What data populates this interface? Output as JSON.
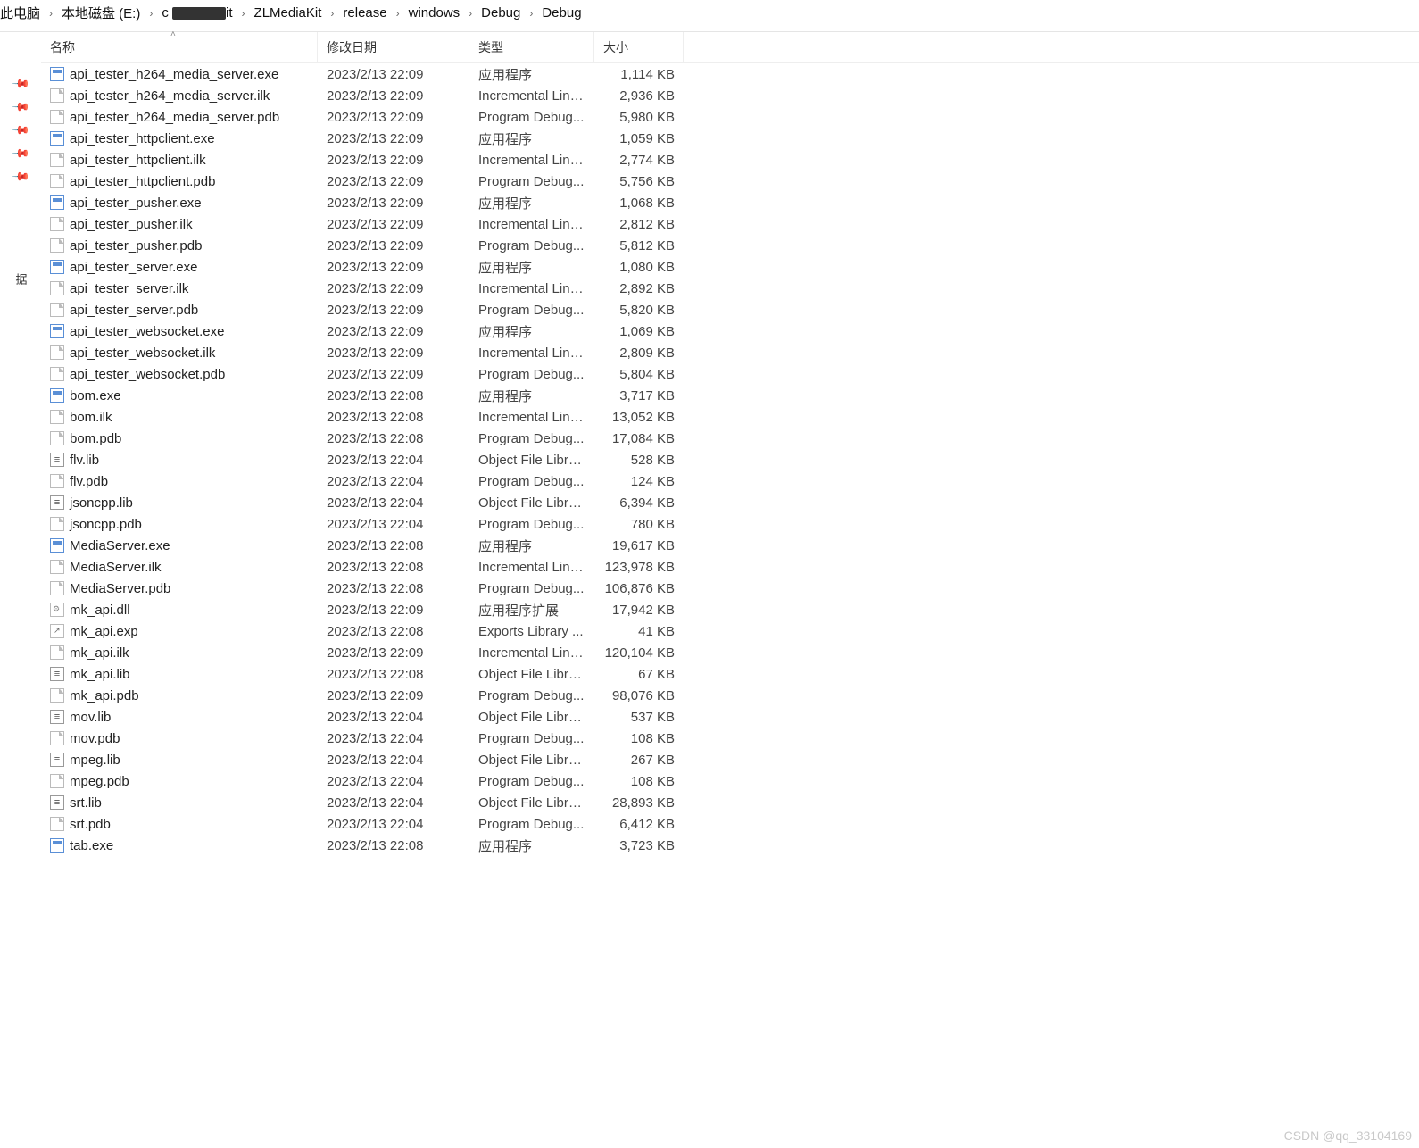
{
  "breadcrumb": {
    "segments": [
      "此电脑",
      "本地磁盘 (E:)",
      "c",
      "ZLMediaKit",
      "release",
      "windows",
      "Debug",
      "Debug"
    ],
    "redacted_index": 2,
    "redacted_suffix": "it"
  },
  "columns": {
    "name": "名称",
    "date": "修改日期",
    "type": "类型",
    "size": "大小"
  },
  "quick_pins_count": 5,
  "quick_label": "据",
  "type_labels": {
    "app": "应用程序",
    "ilk": "Incremental Link...",
    "pdb": "Program Debug...",
    "lib": "Object File Library",
    "dll": "应用程序扩展",
    "exp": "Exports Library ..."
  },
  "files": [
    {
      "icon": "exe",
      "name": "api_tester_h264_media_server.exe",
      "date": "2023/2/13 22:09",
      "type": "app",
      "size": "1,114 KB"
    },
    {
      "icon": "file",
      "name": "api_tester_h264_media_server.ilk",
      "date": "2023/2/13 22:09",
      "type": "ilk",
      "size": "2,936 KB"
    },
    {
      "icon": "file",
      "name": "api_tester_h264_media_server.pdb",
      "date": "2023/2/13 22:09",
      "type": "pdb",
      "size": "5,980 KB"
    },
    {
      "icon": "exe",
      "name": "api_tester_httpclient.exe",
      "date": "2023/2/13 22:09",
      "type": "app",
      "size": "1,059 KB"
    },
    {
      "icon": "file",
      "name": "api_tester_httpclient.ilk",
      "date": "2023/2/13 22:09",
      "type": "ilk",
      "size": "2,774 KB"
    },
    {
      "icon": "file",
      "name": "api_tester_httpclient.pdb",
      "date": "2023/2/13 22:09",
      "type": "pdb",
      "size": "5,756 KB"
    },
    {
      "icon": "exe",
      "name": "api_tester_pusher.exe",
      "date": "2023/2/13 22:09",
      "type": "app",
      "size": "1,068 KB"
    },
    {
      "icon": "file",
      "name": "api_tester_pusher.ilk",
      "date": "2023/2/13 22:09",
      "type": "ilk",
      "size": "2,812 KB"
    },
    {
      "icon": "file",
      "name": "api_tester_pusher.pdb",
      "date": "2023/2/13 22:09",
      "type": "pdb",
      "size": "5,812 KB"
    },
    {
      "icon": "exe",
      "name": "api_tester_server.exe",
      "date": "2023/2/13 22:09",
      "type": "app",
      "size": "1,080 KB"
    },
    {
      "icon": "file",
      "name": "api_tester_server.ilk",
      "date": "2023/2/13 22:09",
      "type": "ilk",
      "size": "2,892 KB"
    },
    {
      "icon": "file",
      "name": "api_tester_server.pdb",
      "date": "2023/2/13 22:09",
      "type": "pdb",
      "size": "5,820 KB"
    },
    {
      "icon": "exe",
      "name": "api_tester_websocket.exe",
      "date": "2023/2/13 22:09",
      "type": "app",
      "size": "1,069 KB"
    },
    {
      "icon": "file",
      "name": "api_tester_websocket.ilk",
      "date": "2023/2/13 22:09",
      "type": "ilk",
      "size": "2,809 KB"
    },
    {
      "icon": "file",
      "name": "api_tester_websocket.pdb",
      "date": "2023/2/13 22:09",
      "type": "pdb",
      "size": "5,804 KB"
    },
    {
      "icon": "exe",
      "name": "bom.exe",
      "date": "2023/2/13 22:08",
      "type": "app",
      "size": "3,717 KB"
    },
    {
      "icon": "file",
      "name": "bom.ilk",
      "date": "2023/2/13 22:08",
      "type": "ilk",
      "size": "13,052 KB"
    },
    {
      "icon": "file",
      "name": "bom.pdb",
      "date": "2023/2/13 22:08",
      "type": "pdb",
      "size": "17,084 KB"
    },
    {
      "icon": "lib",
      "name": "flv.lib",
      "date": "2023/2/13 22:04",
      "type": "lib",
      "size": "528 KB"
    },
    {
      "icon": "file",
      "name": "flv.pdb",
      "date": "2023/2/13 22:04",
      "type": "pdb",
      "size": "124 KB"
    },
    {
      "icon": "lib",
      "name": "jsoncpp.lib",
      "date": "2023/2/13 22:04",
      "type": "lib",
      "size": "6,394 KB"
    },
    {
      "icon": "file",
      "name": "jsoncpp.pdb",
      "date": "2023/2/13 22:04",
      "type": "pdb",
      "size": "780 KB"
    },
    {
      "icon": "exe",
      "name": "MediaServer.exe",
      "date": "2023/2/13 22:08",
      "type": "app",
      "size": "19,617 KB"
    },
    {
      "icon": "file",
      "name": "MediaServer.ilk",
      "date": "2023/2/13 22:08",
      "type": "ilk",
      "size": "123,978 KB"
    },
    {
      "icon": "file",
      "name": "MediaServer.pdb",
      "date": "2023/2/13 22:08",
      "type": "pdb",
      "size": "106,876 KB"
    },
    {
      "icon": "dll",
      "name": "mk_api.dll",
      "date": "2023/2/13 22:09",
      "type": "dll",
      "size": "17,942 KB"
    },
    {
      "icon": "exp",
      "name": "mk_api.exp",
      "date": "2023/2/13 22:08",
      "type": "exp",
      "size": "41 KB"
    },
    {
      "icon": "file",
      "name": "mk_api.ilk",
      "date": "2023/2/13 22:09",
      "type": "ilk",
      "size": "120,104 KB"
    },
    {
      "icon": "lib",
      "name": "mk_api.lib",
      "date": "2023/2/13 22:08",
      "type": "lib",
      "size": "67 KB"
    },
    {
      "icon": "file",
      "name": "mk_api.pdb",
      "date": "2023/2/13 22:09",
      "type": "pdb",
      "size": "98,076 KB"
    },
    {
      "icon": "lib",
      "name": "mov.lib",
      "date": "2023/2/13 22:04",
      "type": "lib",
      "size": "537 KB"
    },
    {
      "icon": "file",
      "name": "mov.pdb",
      "date": "2023/2/13 22:04",
      "type": "pdb",
      "size": "108 KB"
    },
    {
      "icon": "lib",
      "name": "mpeg.lib",
      "date": "2023/2/13 22:04",
      "type": "lib",
      "size": "267 KB"
    },
    {
      "icon": "file",
      "name": "mpeg.pdb",
      "date": "2023/2/13 22:04",
      "type": "pdb",
      "size": "108 KB"
    },
    {
      "icon": "lib",
      "name": "srt.lib",
      "date": "2023/2/13 22:04",
      "type": "lib",
      "size": "28,893 KB"
    },
    {
      "icon": "file",
      "name": "srt.pdb",
      "date": "2023/2/13 22:04",
      "type": "pdb",
      "size": "6,412 KB"
    },
    {
      "icon": "exe",
      "name": "tab.exe",
      "date": "2023/2/13 22:08",
      "type": "app",
      "size": "3,723 KB"
    }
  ],
  "watermark": "CSDN @qq_33104169"
}
